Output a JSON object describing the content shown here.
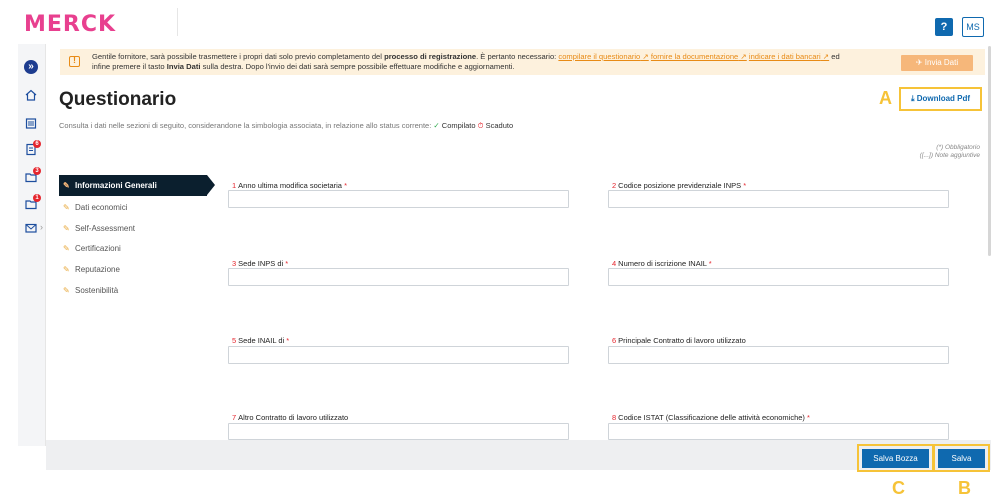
{
  "header": {
    "logo": "MERCK",
    "help_label": "?",
    "user_initials": "MS"
  },
  "sidebar": {
    "expand_icon": "double-chevron-right-icon",
    "items": [
      {
        "icon": "home-icon",
        "badge": ""
      },
      {
        "icon": "building-icon",
        "badge": ""
      },
      {
        "icon": "clipboard-icon",
        "badge": "6"
      },
      {
        "icon": "folder-icon",
        "badge": "3"
      },
      {
        "icon": "folder-icon",
        "badge": "1"
      },
      {
        "icon": "mail-icon",
        "badge": ""
      }
    ]
  },
  "alert": {
    "t1": "Gentile fornitore, sarà possibile trasmettere i propri dati solo previo completamento del ",
    "b1": "processo di registrazione",
    "t2": ". È pertanto necessario: ",
    "l1": "compilare il questionario",
    "l2": "fornire la documentazione",
    "l3": "indicare i dati bancari",
    "t3": " ed",
    "t4": "infine premere il tasto ",
    "b2": "Invia Dati",
    "t5": " sulla destra. Dopo l'invio dei dati sarà sempre possibile effettuare modifiche e aggiornamenti.",
    "button": "Invia Dati"
  },
  "page": {
    "title": "Questionario",
    "subtitle": "Consulta i dati nelle sezioni di seguito, considerandone la simbologia associata, in relazione allo status corrente:",
    "status_ok": "Compilato",
    "status_late": "Scaduto",
    "download_label": "Download Pdf",
    "legend_required": "(*) Obbligatorio",
    "legend_notes": "([...]) Note aggiuntive"
  },
  "markers": {
    "a": "A",
    "b": "B",
    "c": "C"
  },
  "menu": [
    {
      "label": "Informazioni Generali"
    },
    {
      "label": "Dati economici"
    },
    {
      "label": "Self-Assessment"
    },
    {
      "label": "Certificazioni"
    },
    {
      "label": "Reputazione"
    },
    {
      "label": "Sostenibilità"
    }
  ],
  "fields": [
    {
      "num": "1",
      "label": "Anno ultima modifica societaria",
      "req": "*",
      "value": ""
    },
    {
      "num": "2",
      "label": "Codice posizione previdenziale INPS",
      "req": "*",
      "value": ""
    },
    {
      "num": "3",
      "label": "Sede INPS di",
      "req": "*",
      "value": ""
    },
    {
      "num": "4",
      "label": "Numero di iscrizione INAIL",
      "req": "*",
      "value": ""
    },
    {
      "num": "5",
      "label": "Sede INAIL di",
      "req": "*",
      "value": ""
    },
    {
      "num": "6",
      "label": "Principale Contratto di lavoro utilizzato",
      "req": "",
      "value": ""
    },
    {
      "num": "7",
      "label": "Altro Contratto di lavoro utilizzato",
      "req": "",
      "value": ""
    },
    {
      "num": "8",
      "label": "Codice ISTAT (Classificazione delle attività economiche)",
      "req": "*",
      "value": ""
    }
  ],
  "footer": {
    "draft_label": "Salva Bozza",
    "save_label": "Salva"
  },
  "colors": {
    "brand": "#e8408f",
    "primary": "#0f69af",
    "highlight": "#f6c338",
    "alert_bg": "#fdf1dd"
  }
}
